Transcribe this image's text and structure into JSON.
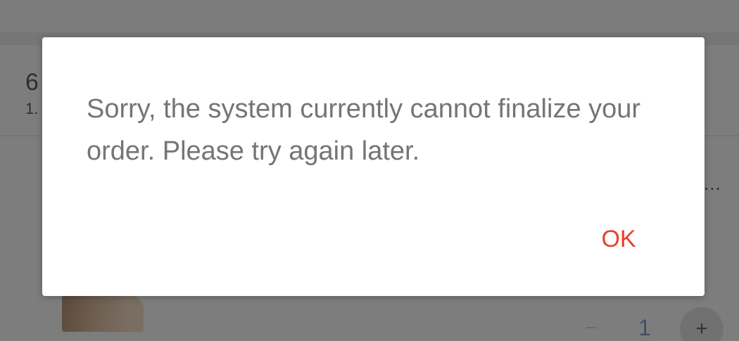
{
  "background": {
    "title_fragment": "6",
    "subtitle_fragment": "1.",
    "overflow_ellipsis": "...",
    "quantity_stepper": {
      "minus_label": "−",
      "value": "1",
      "plus_label": "+"
    }
  },
  "dialog": {
    "message": "Sorry, the system currently cannot finalize your order. Please try again later.",
    "ok_label": "OK"
  },
  "colors": {
    "accent": "#e8412b",
    "message_text": "#757575",
    "scrim": "#7a7a7a"
  }
}
